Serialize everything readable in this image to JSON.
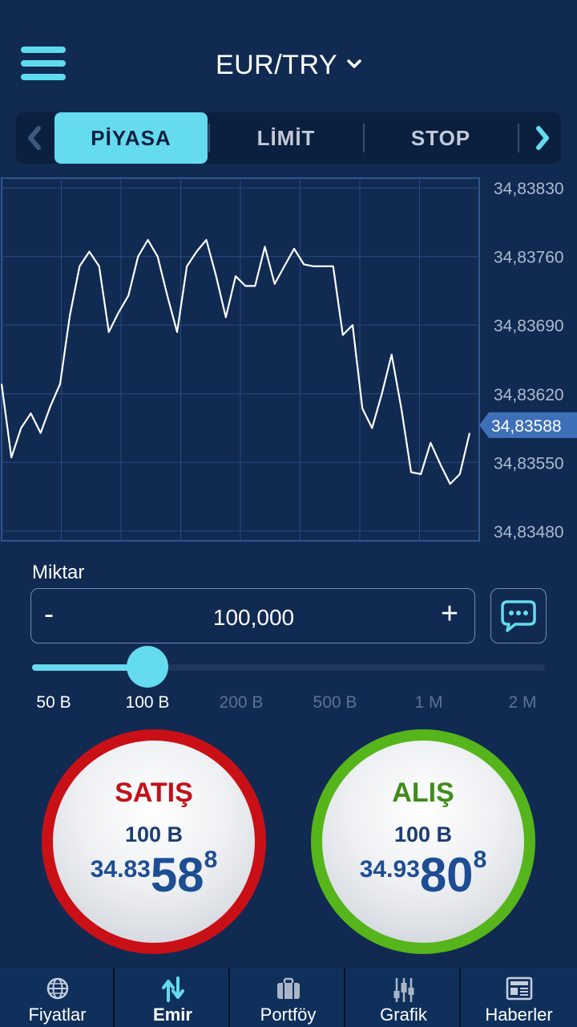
{
  "header": {
    "pair": "EUR/TRY",
    "chevron": "▾"
  },
  "tabs": {
    "prev_arrow": "‹",
    "next_arrow": "›",
    "items": [
      {
        "label": "PİYASA",
        "active": true
      },
      {
        "label": "LİMİT",
        "active": false
      },
      {
        "label": "STOP",
        "active": false
      }
    ]
  },
  "chart_data": {
    "type": "line",
    "y_tick_labels": [
      "34,83830",
      "34,83760",
      "34,83690",
      "34,83620",
      "34,83550",
      "34,83480"
    ],
    "y_ticks": [
      34.8383,
      34.8376,
      34.8369,
      34.8362,
      34.8355,
      34.8348
    ],
    "ylim": [
      34.8347,
      34.8384
    ],
    "current_value_label": "34,83588",
    "current_value": 34.83588,
    "grid": true,
    "values": [
      34.8363,
      34.83555,
      34.83585,
      34.836,
      34.8358,
      34.83607,
      34.8363,
      34.837,
      34.8375,
      34.83765,
      34.8375,
      34.83683,
      34.83703,
      34.8372,
      34.8376,
      34.83777,
      34.8376,
      34.8372,
      34.83683,
      34.8375,
      34.83765,
      34.83777,
      34.8374,
      34.83698,
      34.8374,
      34.8373,
      34.8373,
      34.8377,
      34.83732,
      34.8375,
      34.83768,
      34.83752,
      34.8375,
      34.8375,
      34.8375,
      34.8368,
      34.8369,
      34.83605,
      34.83585,
      34.8362,
      34.8366,
      34.83605,
      34.8354,
      34.83538,
      34.8357,
      34.83548,
      34.83528,
      34.83538,
      34.8358
    ]
  },
  "amount": {
    "label": "Miktar",
    "value": "100,000",
    "minus": "-",
    "plus": "+"
  },
  "slider": {
    "stops": [
      "50 B",
      "100 B",
      "200 B",
      "500 B",
      "1 M",
      "2 M"
    ],
    "selected_index": 1
  },
  "sell": {
    "label": "SATIŞ",
    "amount": "100 B",
    "price_prefix": "34.83",
    "price_big": "58",
    "price_sup": "8"
  },
  "buy": {
    "label": "ALIŞ",
    "amount": "100 B",
    "price_prefix": "34.93",
    "price_big": "80",
    "price_sup": "8"
  },
  "nav": [
    {
      "label": "Fiyatlar",
      "icon": "globe-icon",
      "active": false
    },
    {
      "label": "Emir",
      "icon": "order-arrows-icon",
      "active": true
    },
    {
      "label": "Portföy",
      "icon": "briefcase-icon",
      "active": false
    },
    {
      "label": "Grafik",
      "icon": "chart-sliders-icon",
      "active": false
    },
    {
      "label": "Haberler",
      "icon": "news-icon",
      "active": false
    }
  ],
  "colors": {
    "background": "#102a52",
    "accent": "#64dbee",
    "sell": "#c91016",
    "buy": "#56b51b"
  }
}
